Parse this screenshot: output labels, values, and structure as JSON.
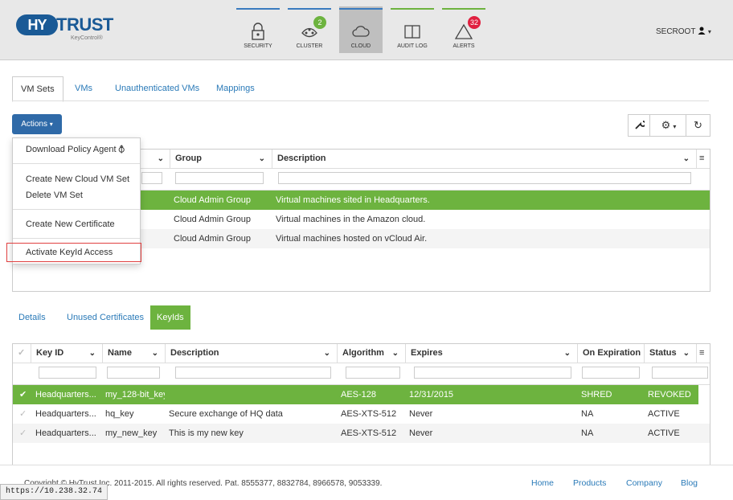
{
  "header": {
    "logo_main": "HY",
    "logo_rest": "TRUST",
    "logo_sub": "KeyControl®",
    "nav": [
      {
        "label": "SECURITY",
        "icon": "lock-icon",
        "bar_color": "#3a7bbf"
      },
      {
        "label": "CLUSTER",
        "icon": "cluster-icon",
        "badge": "2",
        "badge_color": "#6db33f",
        "bar_color": "#3a7bbf"
      },
      {
        "label": "CLOUD",
        "icon": "cloud-icon",
        "bar_color": "#3a7bbf",
        "active": true
      },
      {
        "label": "AUDIT LOG",
        "icon": "book-icon",
        "bar_color": "#6db33f"
      },
      {
        "label": "ALERTS",
        "icon": "warning-icon",
        "badge": "32",
        "badge_color": "#e02040",
        "bar_color": "#6db33f"
      }
    ],
    "user": "SECROOT"
  },
  "tabs": [
    "VM Sets",
    "VMs",
    "Unauthenticated VMs",
    "Mappings"
  ],
  "actions_label": "Actions",
  "menu": {
    "items": [
      "Download Policy Agent",
      "Create New Cloud VM Set",
      "Delete VM Set",
      "Create New Certificate",
      "Activate KeyId Access"
    ]
  },
  "vmsets": {
    "columns": [
      "Group",
      "Description"
    ],
    "rows": [
      {
        "group": "Cloud Admin Group",
        "description": "Virtual machines sited in Headquarters."
      },
      {
        "group": "Cloud Admin Group",
        "description": "Virtual machines in the Amazon cloud."
      },
      {
        "group": "Cloud Admin Group",
        "description": "Virtual machines hosted on vCloud Air."
      }
    ]
  },
  "subtabs": [
    "Details",
    "Unused Certificates",
    "KeyIds"
  ],
  "keyids": {
    "columns": [
      "Key ID",
      "Name",
      "Description",
      "Algorithm",
      "Expires",
      "On Expiration",
      "Status"
    ],
    "rows": [
      {
        "key_id": "Headquarters...",
        "name": "my_128-bit_key",
        "description": "",
        "algorithm": "AES-128",
        "expires": "12/31/2015",
        "on_expiration": "SHRED",
        "status": "REVOKED"
      },
      {
        "key_id": "Headquarters...",
        "name": "hq_key",
        "description": "Secure exchange of HQ data",
        "algorithm": "AES-XTS-512",
        "expires": "Never",
        "on_expiration": "NA",
        "status": "ACTIVE"
      },
      {
        "key_id": "Headquarters...",
        "name": "my_new_key",
        "description": "This is my new key",
        "algorithm": "AES-XTS-512",
        "expires": "Never",
        "on_expiration": "NA",
        "status": "ACTIVE"
      }
    ]
  },
  "footer": {
    "copyright": "Copyright © HyTrust Inc. 2011-2015. All rights reserved. Pat. 8555377, 8832784, 8966578, 9053339.",
    "links": [
      "Home",
      "Products",
      "Company",
      "Blog"
    ]
  },
  "status_url": "https://10.238.32.74",
  "colors": {
    "accent_green": "#6db33f",
    "primary_blue": "#2f6aa8",
    "link_blue": "#2a7ab8",
    "alert_red": "#e02040"
  }
}
